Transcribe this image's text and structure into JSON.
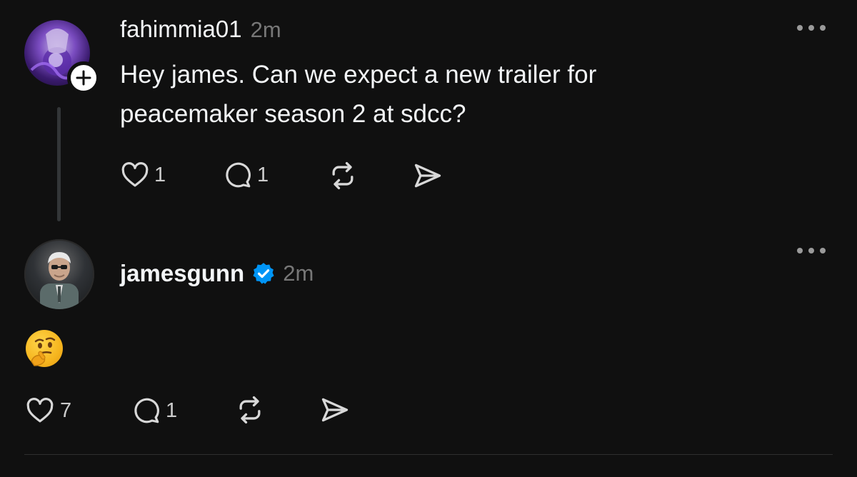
{
  "posts": [
    {
      "username": "fahimmia01",
      "time": "2m",
      "text_line1": "Hey james. Can we expect a new trailer for",
      "text_line2": "peacemaker season 2 at sdcc?",
      "likes": "1",
      "replies": "1"
    },
    {
      "username": "jamesgunn",
      "time": "2m",
      "verified": true,
      "emoji": "thinking-face",
      "likes": "7",
      "replies": "1"
    }
  ],
  "icons": {
    "like": "heart-icon",
    "reply": "speech-bubble-icon",
    "repost": "repost-icon",
    "share": "send-icon",
    "more": "more-dots-icon",
    "follow": "plus-icon",
    "verified": "verified-badge-icon"
  },
  "colors": {
    "background": "#101010",
    "text": "#f3f5f7",
    "muted": "#777777",
    "verified": "#0095f6"
  }
}
